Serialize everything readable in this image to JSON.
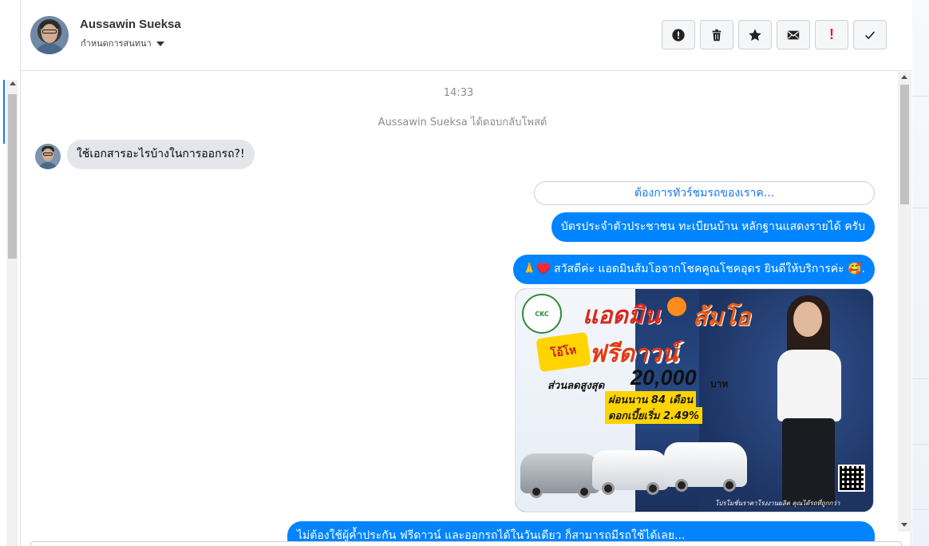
{
  "header": {
    "user_name": "Aussawin Sueksa",
    "assign_label": "กำหนดการสนทนา",
    "toolbar": [
      {
        "name": "report-button",
        "icon": "exclamation-circle-icon"
      },
      {
        "name": "delete-button",
        "icon": "trash-icon"
      },
      {
        "name": "star-button",
        "icon": "star-icon"
      },
      {
        "name": "mark-unread-button",
        "icon": "envelope-icon"
      },
      {
        "name": "important-button",
        "icon": "exclamation-icon",
        "label": "!"
      },
      {
        "name": "done-button",
        "icon": "check-icon"
      }
    ]
  },
  "conversation": {
    "timestamp": "14:33",
    "replied_notice": "Aussawin Sueksa ได้ตอบกลับโพสต์",
    "incoming_message": "ใช้เอกสารอะไรบ้างในการออกรถ?!",
    "quick_reply": "ต้องการทัวร์ชมรถของเราค...",
    "outgoing_1": "บัตรประจำตัวประชาชน ทะเบียนบ้าน หลักฐานแสดงรายได้ ครับ",
    "outgoing_2": "🙏♥️ สวัสดีค่ะ แอดมินส้มโอจากโชคคูณโชคอุดร ยินดีให้บริการค่ะ 🥰.",
    "outgoing_3": "ไม่ต้องใช้ผู้ค้ำประกัน ฟรีดาวน์ และออกรถได้ในวันเดียว ก็สามารถมีรถใช้ได้เลย...",
    "promo": {
      "logo_text": "CKC",
      "title_admin": "แอดมิน",
      "title_som": "ส้มโอ",
      "burst": "โอ้โห",
      "free_down": "ฟรีดาวน์",
      "discount_label": "ส่วนลดสูงสุด",
      "amount": "20,000",
      "baht": "บาท",
      "months": "ผ่อนนาน 84 เดือน",
      "rate": "ดอกเบี้ยเริ่ม 2.49%",
      "footer": "โปรโมชั่นราคาโรงงานผลิต คุณได้รถที่ถูกกว่า"
    }
  },
  "colors": {
    "accent": "#1877f2",
    "outgoing_bubble": "#0084ff",
    "incoming_bubble": "#e4e6eb",
    "important_red": "#e02020"
  }
}
